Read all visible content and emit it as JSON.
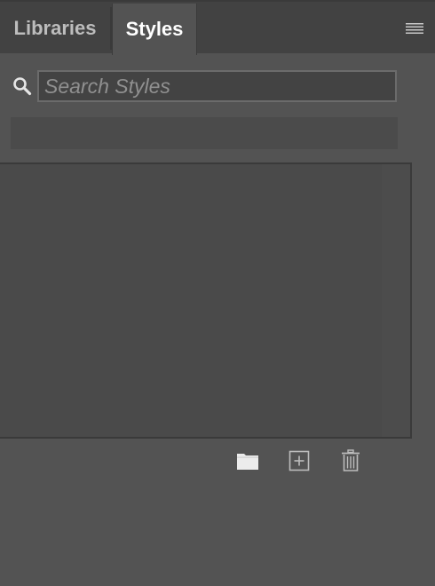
{
  "tabs": [
    {
      "label": "Libraries",
      "active": false
    },
    {
      "label": "Styles",
      "active": true
    }
  ],
  "menu": {
    "icon": "hamburger-menu-icon"
  },
  "search": {
    "value": "",
    "placeholder": "Search Styles",
    "icon": "search-icon"
  },
  "toolbar": {
    "icons": [
      "folder-icon",
      "plus-square-icon",
      "trash-icon"
    ]
  },
  "colors": {
    "panel_bg": "#535353",
    "tabbar_bg": "#424242",
    "active_tab_bg": "#535353",
    "input_bg": "#434343",
    "list_bg": "#4a4a4a"
  }
}
